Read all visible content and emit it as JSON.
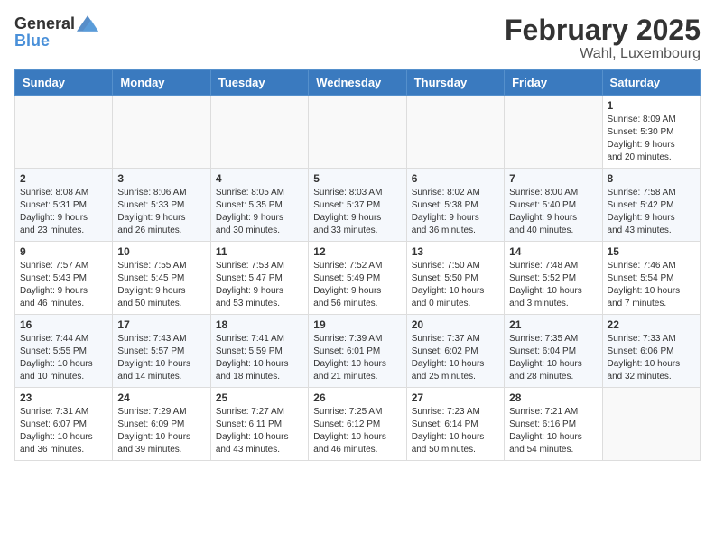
{
  "header": {
    "logo_general": "General",
    "logo_blue": "Blue",
    "month": "February 2025",
    "location": "Wahl, Luxembourg"
  },
  "weekdays": [
    "Sunday",
    "Monday",
    "Tuesday",
    "Wednesday",
    "Thursday",
    "Friday",
    "Saturday"
  ],
  "weeks": [
    [
      {
        "day": "",
        "info": ""
      },
      {
        "day": "",
        "info": ""
      },
      {
        "day": "",
        "info": ""
      },
      {
        "day": "",
        "info": ""
      },
      {
        "day": "",
        "info": ""
      },
      {
        "day": "",
        "info": ""
      },
      {
        "day": "1",
        "info": "Sunrise: 8:09 AM\nSunset: 5:30 PM\nDaylight: 9 hours\nand 20 minutes."
      }
    ],
    [
      {
        "day": "2",
        "info": "Sunrise: 8:08 AM\nSunset: 5:31 PM\nDaylight: 9 hours\nand 23 minutes."
      },
      {
        "day": "3",
        "info": "Sunrise: 8:06 AM\nSunset: 5:33 PM\nDaylight: 9 hours\nand 26 minutes."
      },
      {
        "day": "4",
        "info": "Sunrise: 8:05 AM\nSunset: 5:35 PM\nDaylight: 9 hours\nand 30 minutes."
      },
      {
        "day": "5",
        "info": "Sunrise: 8:03 AM\nSunset: 5:37 PM\nDaylight: 9 hours\nand 33 minutes."
      },
      {
        "day": "6",
        "info": "Sunrise: 8:02 AM\nSunset: 5:38 PM\nDaylight: 9 hours\nand 36 minutes."
      },
      {
        "day": "7",
        "info": "Sunrise: 8:00 AM\nSunset: 5:40 PM\nDaylight: 9 hours\nand 40 minutes."
      },
      {
        "day": "8",
        "info": "Sunrise: 7:58 AM\nSunset: 5:42 PM\nDaylight: 9 hours\nand 43 minutes."
      }
    ],
    [
      {
        "day": "9",
        "info": "Sunrise: 7:57 AM\nSunset: 5:43 PM\nDaylight: 9 hours\nand 46 minutes."
      },
      {
        "day": "10",
        "info": "Sunrise: 7:55 AM\nSunset: 5:45 PM\nDaylight: 9 hours\nand 50 minutes."
      },
      {
        "day": "11",
        "info": "Sunrise: 7:53 AM\nSunset: 5:47 PM\nDaylight: 9 hours\nand 53 minutes."
      },
      {
        "day": "12",
        "info": "Sunrise: 7:52 AM\nSunset: 5:49 PM\nDaylight: 9 hours\nand 56 minutes."
      },
      {
        "day": "13",
        "info": "Sunrise: 7:50 AM\nSunset: 5:50 PM\nDaylight: 10 hours\nand 0 minutes."
      },
      {
        "day": "14",
        "info": "Sunrise: 7:48 AM\nSunset: 5:52 PM\nDaylight: 10 hours\nand 3 minutes."
      },
      {
        "day": "15",
        "info": "Sunrise: 7:46 AM\nSunset: 5:54 PM\nDaylight: 10 hours\nand 7 minutes."
      }
    ],
    [
      {
        "day": "16",
        "info": "Sunrise: 7:44 AM\nSunset: 5:55 PM\nDaylight: 10 hours\nand 10 minutes."
      },
      {
        "day": "17",
        "info": "Sunrise: 7:43 AM\nSunset: 5:57 PM\nDaylight: 10 hours\nand 14 minutes."
      },
      {
        "day": "18",
        "info": "Sunrise: 7:41 AM\nSunset: 5:59 PM\nDaylight: 10 hours\nand 18 minutes."
      },
      {
        "day": "19",
        "info": "Sunrise: 7:39 AM\nSunset: 6:01 PM\nDaylight: 10 hours\nand 21 minutes."
      },
      {
        "day": "20",
        "info": "Sunrise: 7:37 AM\nSunset: 6:02 PM\nDaylight: 10 hours\nand 25 minutes."
      },
      {
        "day": "21",
        "info": "Sunrise: 7:35 AM\nSunset: 6:04 PM\nDaylight: 10 hours\nand 28 minutes."
      },
      {
        "day": "22",
        "info": "Sunrise: 7:33 AM\nSunset: 6:06 PM\nDaylight: 10 hours\nand 32 minutes."
      }
    ],
    [
      {
        "day": "23",
        "info": "Sunrise: 7:31 AM\nSunset: 6:07 PM\nDaylight: 10 hours\nand 36 minutes."
      },
      {
        "day": "24",
        "info": "Sunrise: 7:29 AM\nSunset: 6:09 PM\nDaylight: 10 hours\nand 39 minutes."
      },
      {
        "day": "25",
        "info": "Sunrise: 7:27 AM\nSunset: 6:11 PM\nDaylight: 10 hours\nand 43 minutes."
      },
      {
        "day": "26",
        "info": "Sunrise: 7:25 AM\nSunset: 6:12 PM\nDaylight: 10 hours\nand 46 minutes."
      },
      {
        "day": "27",
        "info": "Sunrise: 7:23 AM\nSunset: 6:14 PM\nDaylight: 10 hours\nand 50 minutes."
      },
      {
        "day": "28",
        "info": "Sunrise: 7:21 AM\nSunset: 6:16 PM\nDaylight: 10 hours\nand 54 minutes."
      },
      {
        "day": "",
        "info": ""
      }
    ]
  ]
}
